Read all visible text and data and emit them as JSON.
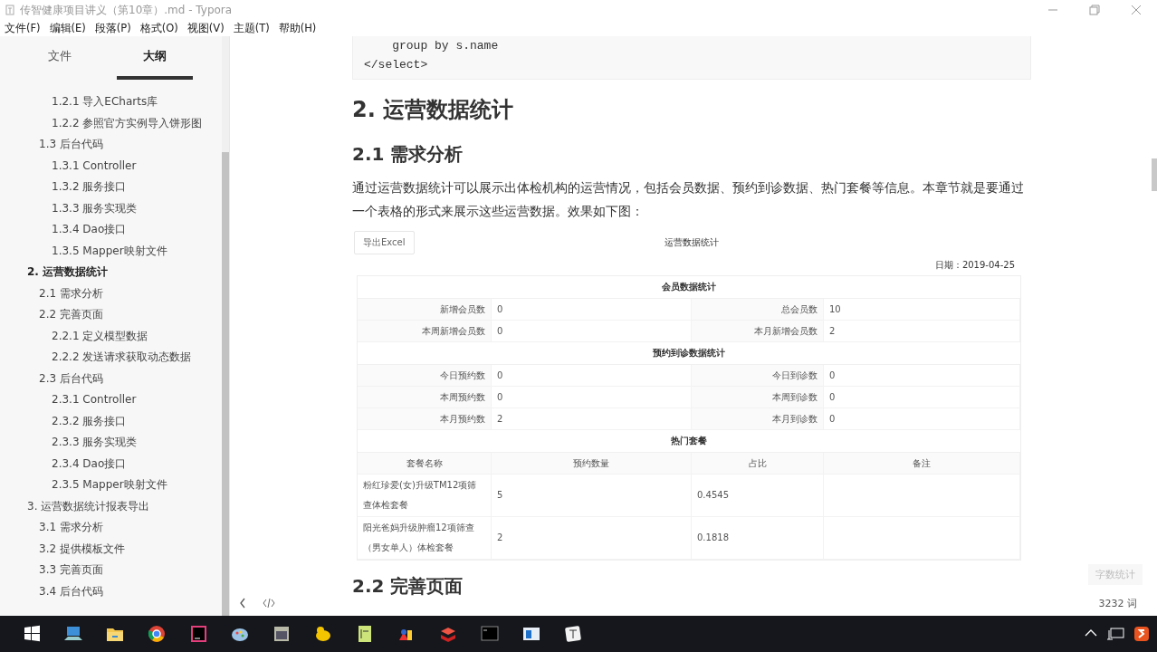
{
  "window": {
    "title": "传智健康项目讲义（第10章）.md - Typora"
  },
  "menu": [
    "文件(F)",
    "编辑(E)",
    "段落(P)",
    "格式(O)",
    "视图(V)",
    "主题(T)",
    "帮助(H)"
  ],
  "sidebar": {
    "tabs": [
      {
        "label": "文件",
        "selected": false
      },
      {
        "label": "大纲",
        "selected": true
      }
    ],
    "outline": [
      {
        "children": [
          {
            "children": [
              {
                "label": "1.2.1 导入ECharts库"
              },
              {
                "label": "1.2.2 参照官方实例导入饼形图"
              }
            ]
          },
          {
            "label": "1.3 后台代码",
            "children": [
              {
                "label": "1.3.1 Controller"
              },
              {
                "label": "1.3.2 服务接口"
              },
              {
                "label": "1.3.3 服务实现类"
              },
              {
                "label": "1.3.4 Dao接口"
              },
              {
                "label": "1.3.5 Mapper映射文件"
              }
            ]
          }
        ]
      },
      {
        "label": "2. 运营数据统计",
        "selected": true,
        "children": [
          {
            "label": "2.1 需求分析"
          },
          {
            "label": "2.2 完善页面",
            "children": [
              {
                "label": "2.2.1 定义模型数据"
              },
              {
                "label": "2.2.2 发送请求获取动态数据"
              }
            ]
          },
          {
            "label": "2.3 后台代码",
            "children": [
              {
                "label": "2.3.1 Controller"
              },
              {
                "label": "2.3.2 服务接口"
              },
              {
                "label": "2.3.3 服务实现类"
              },
              {
                "label": "2.3.4 Dao接口"
              },
              {
                "label": "2.3.5 Mapper映射文件"
              }
            ]
          }
        ]
      },
      {
        "label": "3. 运营数据统计报表导出",
        "selected": false,
        "children": [
          {
            "label": "3.1 需求分析"
          },
          {
            "label": "3.2 提供模板文件"
          },
          {
            "label": "3.3 完善页面"
          },
          {
            "label": "3.4 后台代码"
          }
        ]
      }
    ]
  },
  "document": [
    {
      "kind": "code",
      "lines": [
        "    group by s.name",
        "</select>"
      ]
    },
    {
      "kind": "h2",
      "text": "2. 运营数据统计"
    },
    {
      "kind": "h3",
      "text": "2.1 需求分析"
    },
    {
      "kind": "paragraph",
      "text": "通过运营数据统计可以展示出体检机构的运营情况，包括会员数据、预约到诊数据、热门套餐等信息。本章节就是要通过一个表格的形式来展示这些运营数据。效果如下图："
    },
    {
      "kind": "report",
      "export_button": "导出Excel",
      "title": "运营数据统计",
      "date": "日期：2019-04-25",
      "sections": [
        {
          "kind": "pairs",
          "title": "会员数据统计",
          "rows": [
            [
              "新增会员数",
              "0",
              "总会员数",
              "10"
            ],
            [
              "本周新增会员数",
              "0",
              "本月新增会员数",
              "2"
            ]
          ]
        },
        {
          "kind": "pairs",
          "title": "预约到诊数据统计",
          "rows": [
            [
              "今日预约数",
              "0",
              "今日到诊数",
              "0"
            ],
            [
              "本周预约数",
              "0",
              "本周到诊数",
              "0"
            ],
            [
              "本月预约数",
              "2",
              "本月到诊数",
              "0"
            ]
          ]
        },
        {
          "kind": "table",
          "title": "热门套餐",
          "columns": [
            "套餐名称",
            "预约数量",
            "占比",
            "备注"
          ],
          "rows": [
            [
              "粉红珍爱(女)升级TM12项筛查体检套餐",
              "5",
              "0.4545"
            ],
            [
              "阳光爸妈升级肿瘤12项筛查（男女单人）体检套餐",
              "2",
              "0.1818"
            ]
          ]
        }
      ]
    },
    {
      "kind": "h3",
      "text": "2.2 完善页面"
    }
  ],
  "status": {
    "word_count_button": "字数统计",
    "word_count": "3232 词"
  }
}
